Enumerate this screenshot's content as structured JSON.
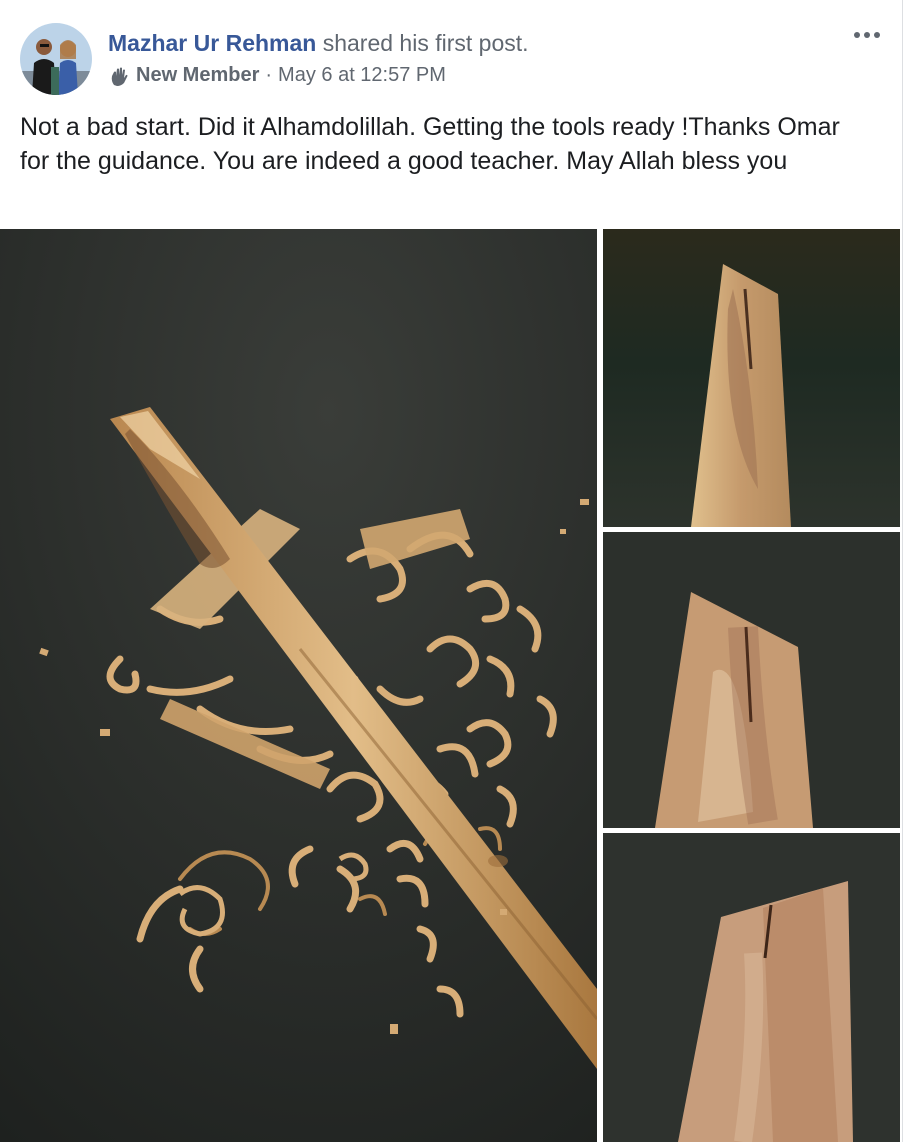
{
  "post": {
    "author": "Mazhar Ur Rehman",
    "action": "shared his first post.",
    "badge": "New Member",
    "separator": "·",
    "timestamp": "May 6 at 12:57 PM",
    "text": "Not a bad start. Did it Alhamdolillah. Getting the tools ready !Thanks Omar for the guidance. You are indeed a good teacher. May Allah bless you"
  },
  "icons": {
    "badge": "waving-hand-icon",
    "menu": "more-options-icon"
  },
  "colors": {
    "author_link": "#385898",
    "meta_text": "#606770",
    "body_text": "#1c1e21",
    "photo_background": "#1f2220",
    "wood": "#c9a06e"
  }
}
